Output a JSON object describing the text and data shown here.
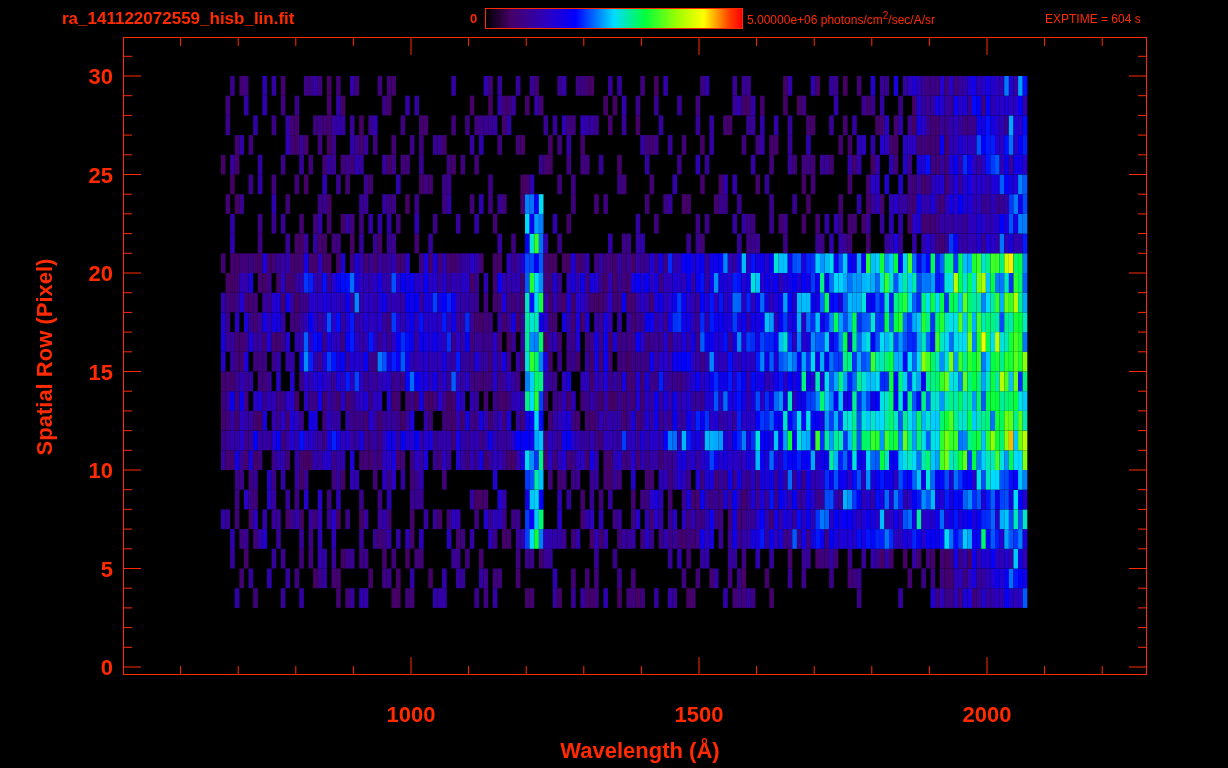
{
  "title": "ra_141122072559_hisb_lin.fit",
  "colorbar": {
    "min_label": "0",
    "max_label": "5.00000e+06 photons/cm$^{2}$/sec/A/sr"
  },
  "exposure": "EXPTIME = 604 s",
  "plot": {
    "xlabel": "Wavelength (Å)",
    "ylabel": "Spatial Row (Pixel)",
    "xtick_labels": [
      "1000",
      "1500",
      "2000"
    ],
    "ytick_labels": [
      "30",
      "25",
      "20",
      "15",
      "10",
      "5",
      "0"
    ]
  }
}
